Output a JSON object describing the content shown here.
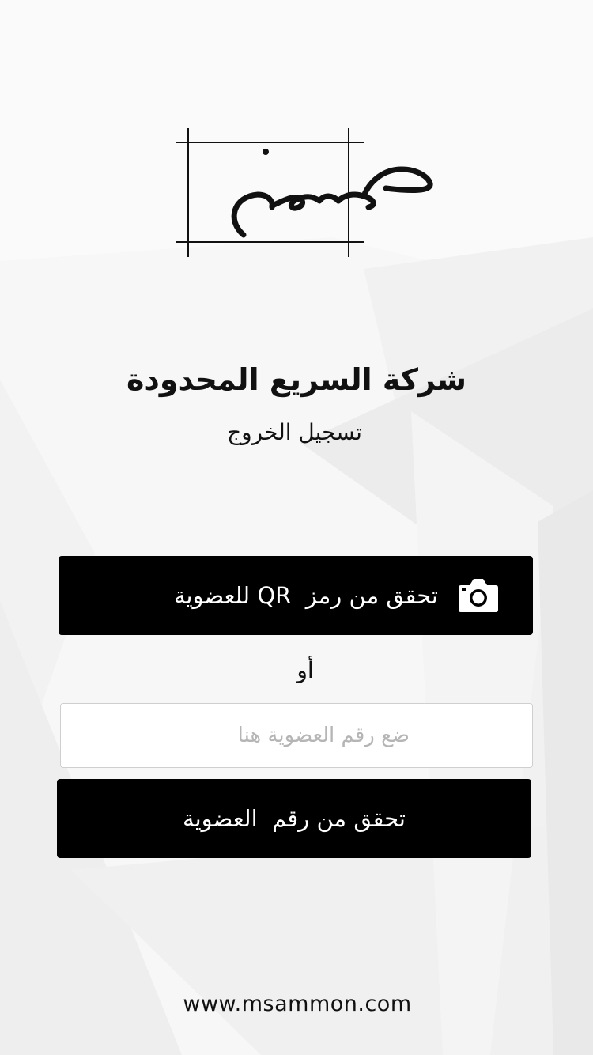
{
  "logo": {
    "wordmark": "مصمون"
  },
  "header": {
    "company_name": "شركة السريع المحدودة",
    "subtitle": "تسجيل الخروج"
  },
  "qr_button": {
    "label": "تحقق من رمز  QR للعضوية",
    "icon": "camera-icon"
  },
  "divider": {
    "or_label": "أو"
  },
  "membership_input": {
    "placeholder": "ضع رقم العضوية هنا",
    "value": ""
  },
  "verify_button": {
    "label": "تحقق من رقم  العضوية"
  },
  "footer": {
    "website": "www.msammon.com"
  },
  "colors": {
    "button_background": "#000000",
    "button_text": "#ffffff",
    "page_background": "#f7f7f7",
    "text": "#111111",
    "placeholder": "#b5b5b5"
  }
}
